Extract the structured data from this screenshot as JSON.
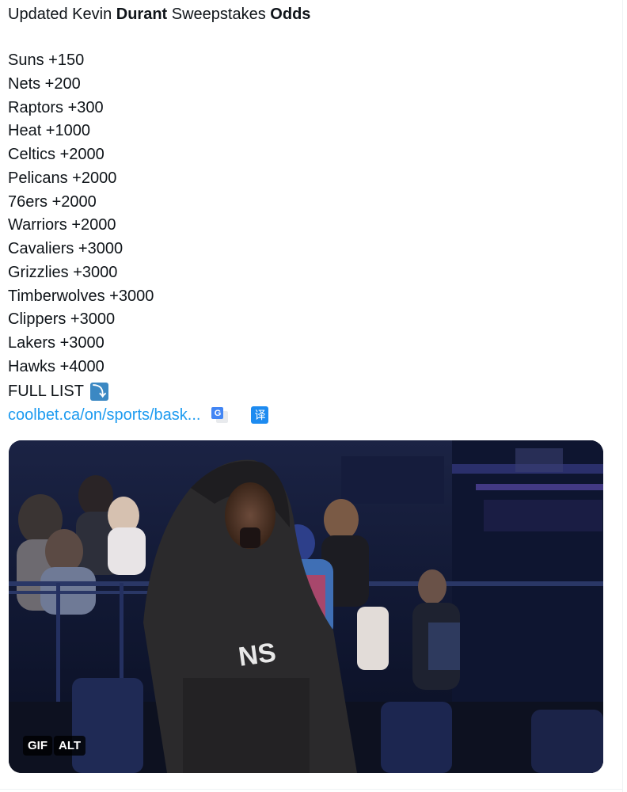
{
  "tweet": {
    "title_parts": {
      "p1": "Updated Kevin ",
      "b1": "Durant",
      "p2": " Sweepstakes ",
      "b2": "Odds"
    },
    "odds": [
      "Suns +150",
      "Nets +200",
      "Raptors +300",
      "Heat +1000",
      "Celtics +2000",
      "Pelicans +2000",
      "76ers +2000",
      "Warriors +2000",
      "Cavaliers +3000",
      "Grizzlies +3000",
      "Timberwolves +3000",
      "Clippers +3000",
      "Lakers +3000",
      "Hawks +4000"
    ],
    "full_list": "FULL LIST",
    "full_list_emoji": "⤵",
    "link_text": "coolbet.ca/on/sports/bask...",
    "translate_icon_glyph": "G",
    "translate_cn_glyph": "译"
  },
  "media": {
    "gif_badge": "GIF",
    "alt_badge": "ALT",
    "shirt_text": "NS"
  },
  "icons": {
    "arrow_emoji": "arrow-right-curving-down-icon",
    "google_translate": "google-translate-icon",
    "chinese_translate": "translate-cn-icon"
  },
  "colors": {
    "link": "#1d9bf0",
    "text": "#0f1419",
    "emoji_bg": "#3b88c3"
  }
}
